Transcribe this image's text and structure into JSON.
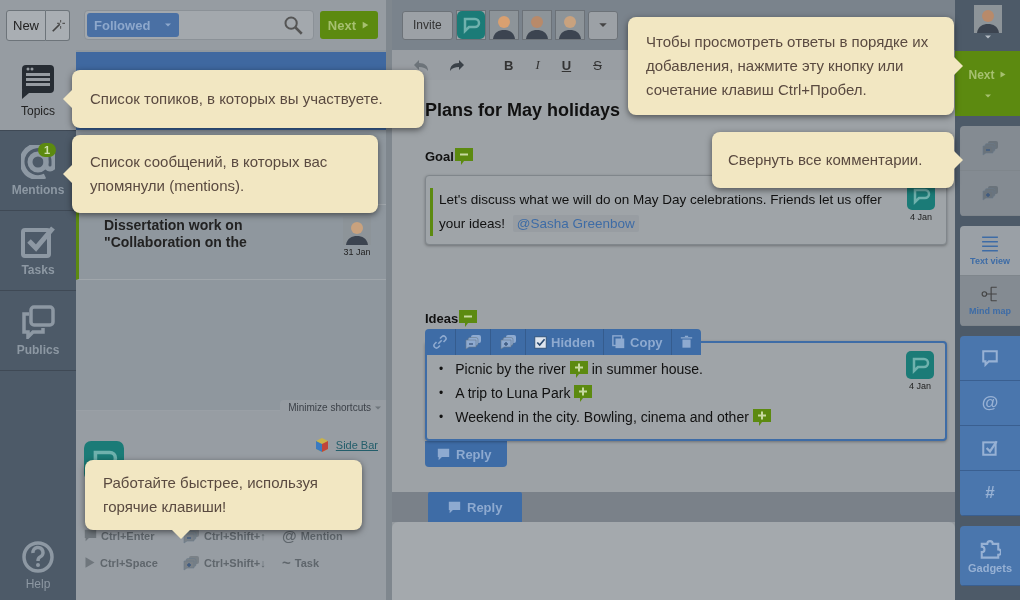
{
  "nav": {
    "new_button": "New",
    "items": [
      {
        "kind": "topics",
        "label": "Topics",
        "selected": true
      },
      {
        "kind": "mentions",
        "label": "Mentions",
        "selected": false,
        "badge": "1"
      },
      {
        "kind": "tasks",
        "label": "Tasks",
        "selected": false
      },
      {
        "kind": "publics",
        "label": "Publics",
        "selected": false
      }
    ],
    "help": "Help"
  },
  "list_panel": {
    "filter": "Followed",
    "next_button": "Next",
    "topics": [
      {
        "title": "Dissertation work on \"Collaboration on the",
        "date": "31 Jan",
        "unread": true
      }
    ],
    "minimize": "Minimize shortcuts",
    "side_bar_link": "Side Bar",
    "shortcuts": [
      {
        "kind": "reply",
        "label": "Ctrl+Enter"
      },
      {
        "kind": "collapse",
        "label": "Ctrl+Shift+↑"
      },
      {
        "kind": "symbol",
        "symbol": "@",
        "label": "Mention"
      },
      {
        "kind": "next",
        "label": "Ctrl+Space"
      },
      {
        "kind": "expand",
        "label": "Ctrl+Shift+↓"
      },
      {
        "kind": "symbol",
        "symbol": "~",
        "label": "Task"
      }
    ]
  },
  "editor": {
    "invite_button": "Invite",
    "participants": [
      {
        "kind": "logo"
      },
      {
        "kind": "person"
      },
      {
        "kind": "person"
      },
      {
        "kind": "person"
      }
    ],
    "format_buttons": [
      "B",
      "I",
      "U",
      "S"
    ],
    "title": "Plans for May holidays",
    "blocks": [
      {
        "kind": "plain",
        "label": "Goal",
        "expanded": true,
        "text": "Let's discuss  what we will do on May Day celebrations. Friends let us offer your ideas!",
        "mention": "@Sasha Greenbow",
        "date": "4 Jan"
      },
      {
        "kind": "active",
        "label": "Ideas",
        "expanded": true,
        "date": "4 Jan",
        "toolbar": {
          "hidden_label": "Hidden",
          "hidden_checked": true,
          "copy_label": "Copy"
        },
        "items": [
          {
            "marker": "•",
            "text": "Picnic by the river",
            "expanded": false,
            "after": "in summer house."
          },
          {
            "marker": "•",
            "text": "A trip to Luna Park",
            "expanded": false
          },
          {
            "marker": "•",
            "text": "Weekend in the city. Bowling, cinema and other",
            "expanded": false
          }
        ],
        "reply_button": "Reply"
      }
    ],
    "reply_button": "Reply"
  },
  "right_bar": {
    "next_button": "Next",
    "views": [
      {
        "label": "Text view",
        "kind": "text",
        "selected": true
      },
      {
        "label": "Mind map",
        "kind": "mind",
        "selected": false
      }
    ],
    "tools": [
      {
        "kind": "comment"
      },
      {
        "kind": "char",
        "char": "@"
      },
      {
        "kind": "check"
      },
      {
        "kind": "char",
        "char": "#"
      }
    ],
    "gadgets": "Gadgets"
  },
  "tips": [
    {
      "kind": "topics",
      "text": "Список топиков, в которых вы участвуете."
    },
    {
      "kind": "mentions",
      "text": "Список сообщений, в которых вас упомянули (mentions)."
    },
    {
      "kind": "next",
      "text": "Чтобы просмотреть ответы в порядке их добавления, нажмите эту кнопку или сочетание клавиш Ctrl+Пробел."
    },
    {
      "kind": "collapse",
      "text": "Свернуть все комментарии."
    },
    {
      "kind": "hotkeys",
      "text": "Работайте быстрее, используя горячие клавиши!"
    }
  ]
}
